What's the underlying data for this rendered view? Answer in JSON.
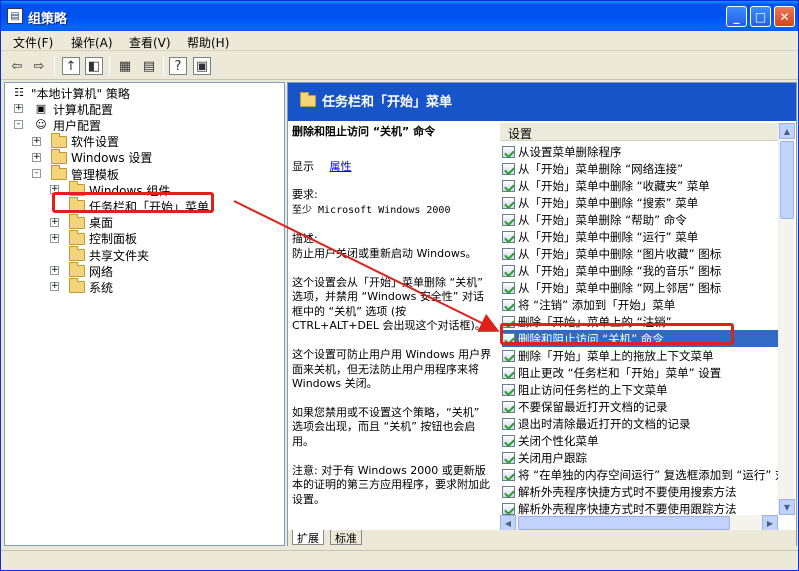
{
  "window": {
    "title": "组策略"
  },
  "menu": [
    "文件(F)",
    "操作(A)",
    "查看(V)",
    "帮助(H)"
  ],
  "tree": [
    {
      "label": "\"本地计算机\" 策略",
      "level": 0,
      "expander": "",
      "icon": "policy-icon"
    },
    {
      "label": "计算机配置",
      "level": 1,
      "expander": "+",
      "icon": "computer-icon"
    },
    {
      "label": "用户配置",
      "level": 1,
      "expander": "-",
      "icon": "user-icon"
    },
    {
      "label": "软件设置",
      "level": 2,
      "expander": "+",
      "icon": "folder-icon"
    },
    {
      "label": "Windows 设置",
      "level": 2,
      "expander": "+",
      "icon": "folder-icon"
    },
    {
      "label": "管理模板",
      "level": 2,
      "expander": "-",
      "icon": "folder-icon"
    },
    {
      "label": "Windows 组件",
      "level": 3,
      "expander": "+",
      "icon": "folder-icon"
    },
    {
      "label": "任务栏和「开始」菜单",
      "level": 3,
      "expander": "",
      "icon": "open-folder-icon"
    },
    {
      "label": "桌面",
      "level": 3,
      "expander": "+",
      "icon": "folder-icon"
    },
    {
      "label": "控制面板",
      "level": 3,
      "expander": "+",
      "icon": "folder-icon"
    },
    {
      "label": "共享文件夹",
      "level": 3,
      "expander": "",
      "icon": "folder-icon"
    },
    {
      "label": "网络",
      "level": 3,
      "expander": "+",
      "icon": "folder-icon"
    },
    {
      "label": "系统",
      "level": 3,
      "expander": "+",
      "icon": "folder-icon"
    }
  ],
  "right": {
    "header": "任务栏和「开始」菜单",
    "desc_title": "删除和阻止访问 “关机” 命令",
    "show_label": "显示",
    "show_link": "属性",
    "req_label": "要求:",
    "req_text": "至少 Microsoft Windows 2000",
    "desc_label": "描述:",
    "desc_text": "防止用户关闭或重新启动 Windows。",
    "p1": "这个设置会从「开始」菜单删除 “关机” 选项，并禁用 “Windows 安全性” 对话框中的 “关机” 选项 (按 CTRL+ALT+DEL 会出现这个对话框)。",
    "p2": "这个设置可防止用户用 Windows 用户界面来关机，但无法防止用户用程序来将 Windows 关闭。",
    "p3": "如果您禁用或不设置这个策略，“关机” 选项会出现，而且 “关机” 按钮也会启用。",
    "p4": "注意: 对于有 Windows 2000 或更新版本的证明的第三方应用程序，要求附加此设置。",
    "settings_header": "设置",
    "settings": [
      "从设置菜单删除程序",
      "从「开始」菜单删除 “网络连接”",
      "从「开始」菜单中删除 “收藏夹” 菜单",
      "从「开始」菜单中删除 “搜索” 菜单",
      "从「开始」菜单删除 “帮助” 命令",
      "从「开始」菜单中删除 “运行” 菜单",
      "从「开始」菜单中删除 “图片收藏” 图标",
      "从「开始」菜单中删除 “我的音乐” 图标",
      "从「开始」菜单中删除 “网上邻居” 图标",
      "将 “注销” 添加到「开始」菜单",
      "删除「开始」菜单上的 “注销”",
      "删除和阻止访问 “关机” 命令",
      "删除「开始」菜单上的拖放上下文菜单",
      "阻止更改 “任务栏和「开始」菜单” 设置",
      "阻止访问任务栏的上下文菜单",
      "不要保留最近打开文档的记录",
      "退出时清除最近打开的文档的记录",
      "关闭个性化菜单",
      "关闭用户跟踪",
      "将 “在单独的内存空间运行” 复选框添加到 “运行” 对话框",
      "解析外壳程序快捷方式时不要使用搜索方法",
      "解析外壳程序快捷方式时不要使用跟踪方法"
    ],
    "selected_index": 11,
    "tabs": [
      "扩展",
      "标准"
    ]
  },
  "colors": {
    "accent": "#316ac5",
    "header": "#1754c8",
    "highlight": "#e0201b"
  }
}
